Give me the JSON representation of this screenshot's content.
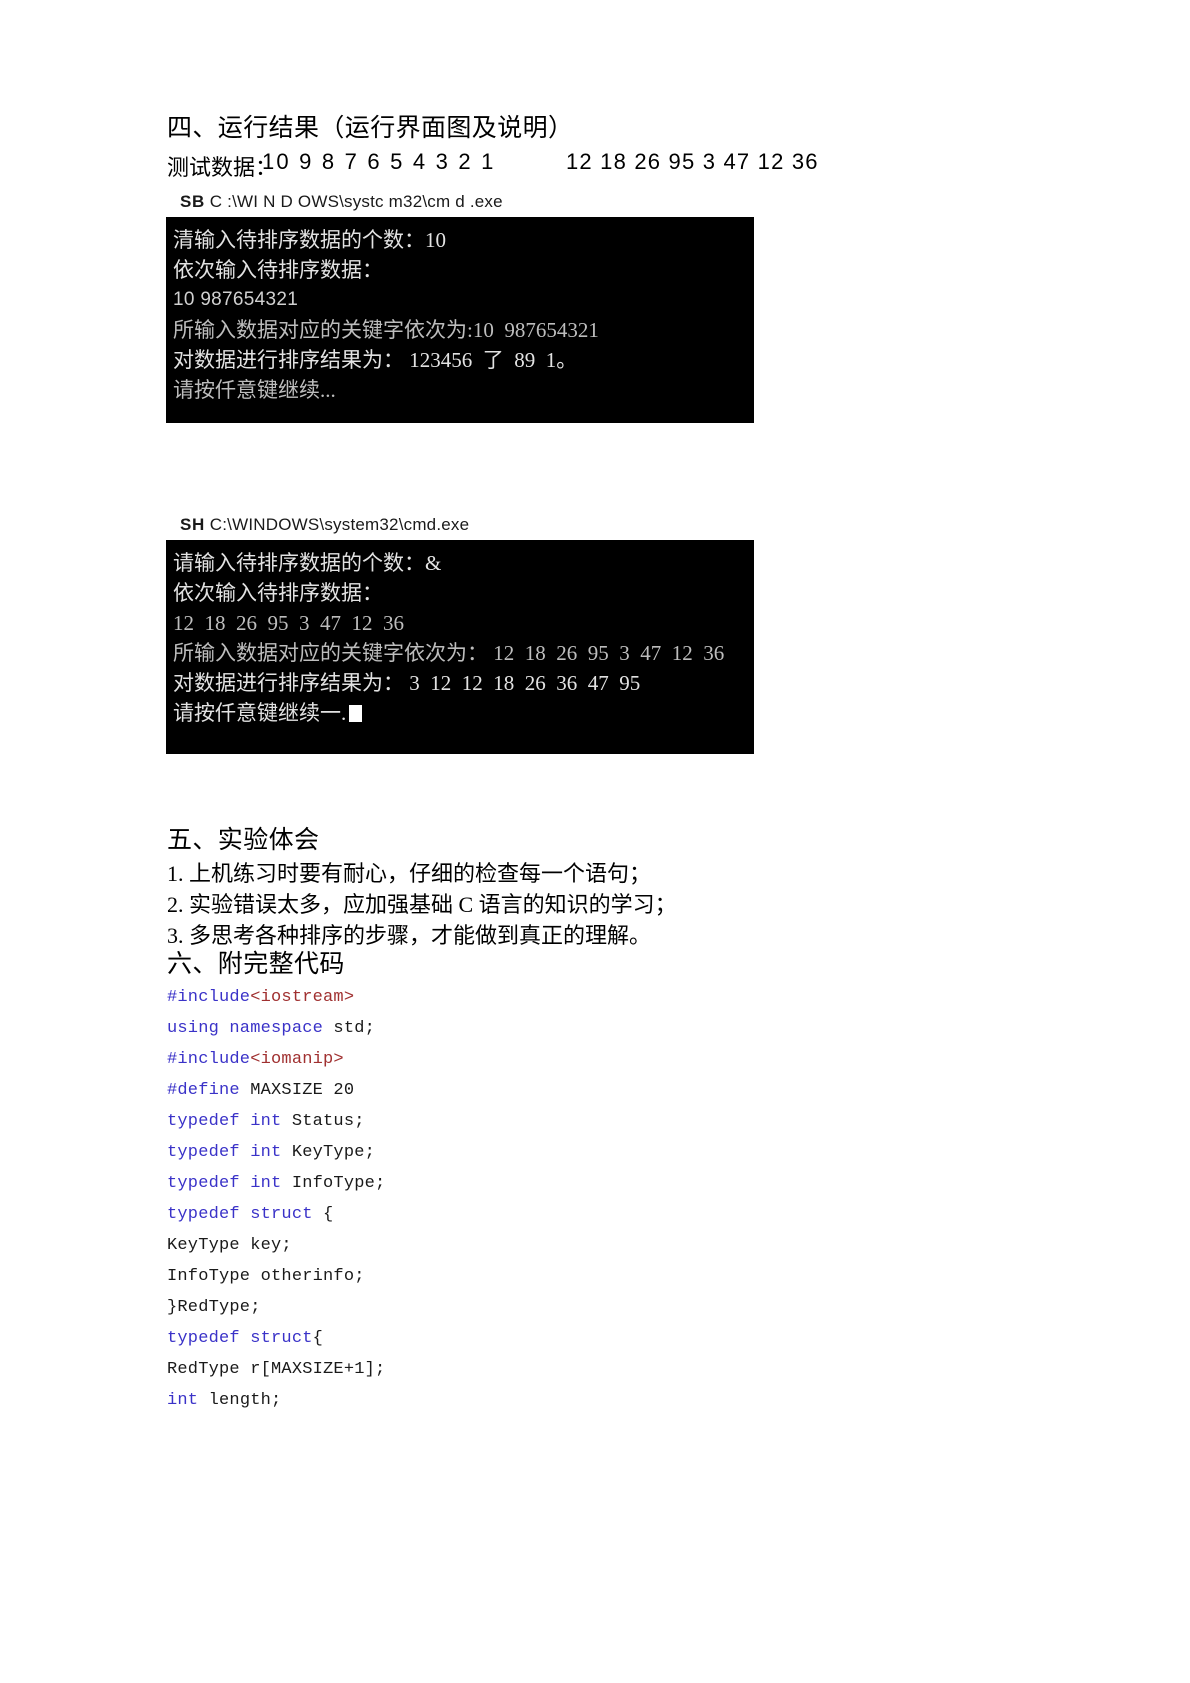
{
  "document": {
    "sections": {
      "results_heading": "四、运行结果（运行界面图及说明）",
      "reflection_heading": "五、实验体会",
      "code_heading": "六、附完整代码"
    },
    "test_data": {
      "label": "测试数据：",
      "set_1": "10 9 8 7 6 5 4 3 2 1",
      "set_2": "12 18 26 95 3 47 12 36"
    },
    "consoles": [
      {
        "app_mark": "SB",
        "title": "C :\\WI N D OWS\\systc m32\\cm d .exe",
        "lines": [
          "清输入待排序数据的个数：10",
          "依次输入待排序数据：",
          "10 987654321",
          "所输入数据对应的关键字依次为:10  987654321",
          "对数据进行排序结果为： 123456  了  89  1。",
          "请按仟意键继续..."
        ]
      },
      {
        "app_mark": "SH",
        "title": "C:\\WINDOWS\\system32\\cmd.exe",
        "lines": [
          "请输入待排序数据的个数：&",
          "依次输入待排序数据：",
          "12  18  26  95  3  47  12  36",
          "所输入数据对应的关键字依次为： 12  18  26  95  3  47  12  36",
          "对数据进行排序结果为： 3  12  12  18  26  36  47  95",
          "请按仟意键继续一."
        ]
      }
    ],
    "reflection_items": [
      "1. 上机练习时要有耐心，仔细的检查每一个语句；",
      "2. 实验错误太多，应加强基础 C 语言的知识的学习；",
      "3. 多思考各种排序的步骤，才能做到真正的理解。"
    ],
    "code_lines": [
      {
        "kw": "#include",
        "hdr": "<iostream>",
        "pln": ""
      },
      {
        "kw": "using namespace",
        "hdr": "",
        "pln": " std;"
      },
      {
        "kw": "#include",
        "hdr": "<iomanip>",
        "pln": ""
      },
      {
        "kw": "#define",
        "hdr": "",
        "pln": " MAXSIZE 20"
      },
      {
        "kw": "typedef int",
        "hdr": "",
        "pln": " Status;"
      },
      {
        "kw": "typedef int",
        "hdr": "",
        "pln": " KeyType;"
      },
      {
        "kw": "typedef int",
        "hdr": "",
        "pln": " InfoType;"
      },
      {
        "kw": "typedef struct",
        "hdr": "",
        "pln": " {"
      },
      {
        "kw": "",
        "hdr": "",
        "pln": "KeyType key;"
      },
      {
        "kw": "",
        "hdr": "",
        "pln": "InfoType otherinfo;"
      },
      {
        "kw": "",
        "hdr": "",
        "pln": "}RedType;"
      },
      {
        "kw": "typedef struct",
        "hdr": "",
        "pln": "{"
      },
      {
        "kw": "",
        "hdr": "",
        "pln": "RedType r[MAXSIZE+1];"
      },
      {
        "kw": "int",
        "hdr": "",
        "pln": " length;"
      }
    ],
    "colors": {
      "keyword": "#3a32c8",
      "header": "#a03030",
      "plain": "#1a1a1a",
      "console_bg": "#000000",
      "console_text": "#bdbdbd"
    }
  }
}
